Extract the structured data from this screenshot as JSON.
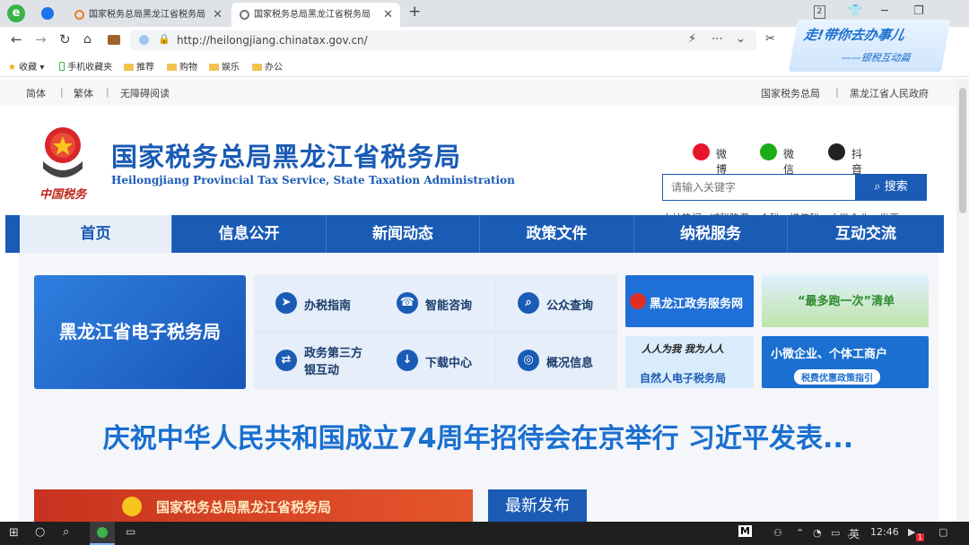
{
  "browser": {
    "tabs": [
      {
        "title": "国家税务总局黑龙江省税务局"
      },
      {
        "title": "国家税务总局黑龙江省税务局"
      }
    ],
    "url": "http://heilongjiang.chinatax.gov.cn/",
    "bookmarks": [
      "收藏",
      "手机收藏夹",
      "推荐",
      "购物",
      "娱乐",
      "办公"
    ],
    "tab_count": "2"
  },
  "promo": {
    "line1": "走!带你去办事儿",
    "line2": "——银税互动篇"
  },
  "topstrip": {
    "left": [
      "简体",
      "繁体",
      "无障碍阅读"
    ],
    "right": [
      "国家税务总局",
      "黑龙江省人民政府"
    ]
  },
  "header": {
    "emblem_caption": "中国税务",
    "title_cn": "国家税务总局黑龙江省税务局",
    "title_en": "Heilongjiang Provincial Tax Service, State Taxation Administration",
    "social": [
      "微博",
      "微信",
      "抖音"
    ],
    "search_placeholder": "请输入关键字",
    "search_button": "搜索",
    "hotwords_label": "本站热词:",
    "hotwords": [
      "减税降费",
      "个税",
      "增值税",
      "小微企业",
      "发票"
    ]
  },
  "nav": [
    "首页",
    "信息公开",
    "新闻动态",
    "政策文件",
    "纳税服务",
    "互动交流"
  ],
  "main": {
    "etax": "黑龙江省电子税务局",
    "services": [
      "办税指南",
      "智能咨询",
      "公众查询",
      "政务第三方银互动",
      "下载中心",
      "概况信息"
    ],
    "banners": [
      "黑龙江政务服务网",
      "“最多跑一次”清单",
      "自然人电子税务局",
      "小微企业、个体工商户",
      "税费优惠政策指引",
      "人人为我 我为人人"
    ],
    "headline": "庆祝中华人民共和国成立74周年招待会在京举行 习近平发表...",
    "red_banner": "国家税务总局黑龙江省税务局",
    "latest": "最新发布"
  },
  "taskbar": {
    "ime": "英",
    "time": "12:46",
    "badge": "1",
    "letter": "M"
  }
}
